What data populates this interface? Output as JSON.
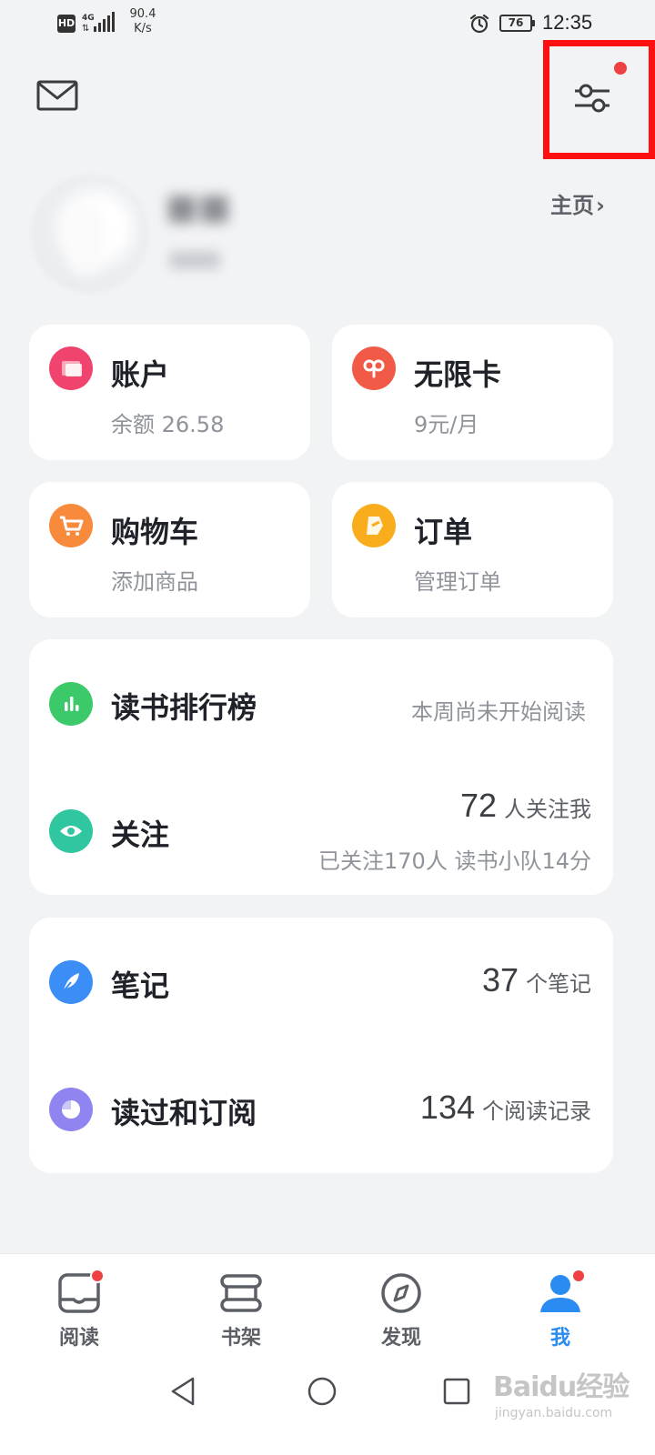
{
  "status_bar": {
    "hd": "HD",
    "network": "4G",
    "speed_value": "90.4",
    "speed_unit": "K/s",
    "battery": "76",
    "time": "12:35"
  },
  "header": {
    "mail_icon": "envelope-icon",
    "settings_icon": "sliders-icon",
    "settings_has_notification": true,
    "highlight_color": "#ff1010"
  },
  "profile": {
    "homepage_label": "主页"
  },
  "tiles": [
    {
      "title": "账户",
      "subtitle": "余额 26.58",
      "icon": "wallet-icon",
      "color": "#f0436e"
    },
    {
      "title": "无限卡",
      "subtitle": "9元/月",
      "icon": "infinity-card-icon",
      "color": "#f25a48"
    },
    {
      "title": "购物车",
      "subtitle": "添加商品",
      "icon": "cart-icon",
      "color": "#f88a3c"
    },
    {
      "title": "订单",
      "subtitle": "管理订单",
      "icon": "order-icon",
      "color": "#f9ad1c"
    }
  ],
  "social_card": {
    "ranking": {
      "title": "读书排行榜",
      "status": "本周尚未开始阅读",
      "icon": "bar-chart-icon",
      "color": "#3cc96a"
    },
    "follow": {
      "title": "关注",
      "followers_count": "72",
      "followers_label": "人关注我",
      "detail": "已关注170人 读书小队14分",
      "icon": "eye-icon",
      "color": "#2fc6a0"
    }
  },
  "notes_card": {
    "notes": {
      "title": "笔记",
      "count": "37",
      "unit": "个笔记",
      "icon": "feather-icon",
      "color": "#3a8ef5"
    },
    "history": {
      "title": "读过和订阅",
      "count": "134",
      "unit": "个阅读记录",
      "icon": "pie-icon",
      "color": "#8f84f0"
    }
  },
  "bottom_nav": [
    {
      "label": "阅读",
      "icon": "reading-icon",
      "badge": true,
      "active": false
    },
    {
      "label": "书架",
      "icon": "bookshelf-icon",
      "badge": false,
      "active": false
    },
    {
      "label": "发现",
      "icon": "compass-icon",
      "badge": false,
      "active": false
    },
    {
      "label": "我",
      "icon": "person-icon",
      "badge": true,
      "active": true
    }
  ],
  "active_color": "#2a8bf2",
  "watermark": {
    "brand": "Baidu经验",
    "url": "jingyan.baidu.com"
  }
}
